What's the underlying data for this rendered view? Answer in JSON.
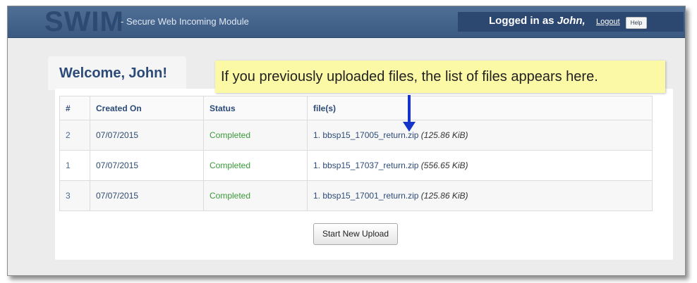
{
  "header": {
    "logo": "SWIM",
    "subtitle": "- Secure Web Incoming Module",
    "logged_in_prefix": "Logged in as",
    "user_name": "John,",
    "logout_label": "Logout",
    "help_label": "Help"
  },
  "main": {
    "welcome": "Welcome, John!",
    "tooltip": "If you previously uploaded files, the list of files appears here.",
    "table": {
      "headers": [
        "#",
        "Created On",
        "Status",
        "file(s)"
      ],
      "rows": [
        {
          "num": "2",
          "created": "07/07/2015",
          "status": "Completed",
          "file": "1.  bbsp15_17005_return.zip",
          "size": "(125.86 KiB)"
        },
        {
          "num": "1",
          "created": "07/07/2015",
          "status": "Completed",
          "file": "1.  bbsp15_17037_return.zip",
          "size": "(556.65 KiB)"
        },
        {
          "num": "3",
          "created": "07/07/2015",
          "status": "Completed",
          "file": "1.  bbsp15_17001_return.zip",
          "size": "(125.86 KiB)"
        }
      ]
    },
    "start_button": "Start New Upload"
  },
  "colors": {
    "header_bg": "#3b5a82",
    "tooltip_bg": "#fbf8a6",
    "status_green": "#3a9a3a",
    "arrow_blue": "#1634c8"
  },
  "icons": {
    "tooltip_arrow": "down-arrow-icon"
  }
}
